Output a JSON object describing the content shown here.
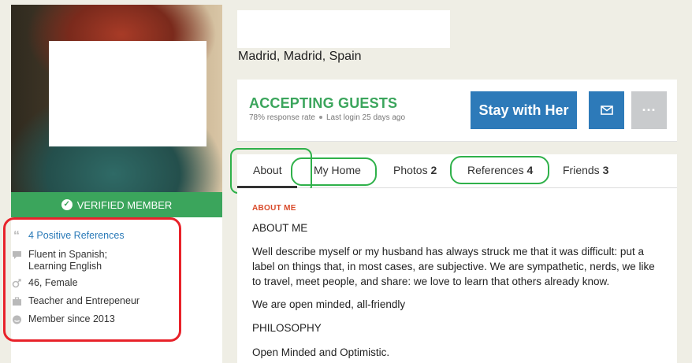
{
  "profile": {
    "verified_label": "VERIFIED MEMBER",
    "info": [
      {
        "icon": "quote-icon",
        "text": "4 Positive References",
        "link": true
      },
      {
        "icon": "speech-bubble-icon",
        "text": "Fluent in Spanish;",
        "text2": "Learning English"
      },
      {
        "icon": "gender-icon",
        "text": "46, Female"
      },
      {
        "icon": "briefcase-icon",
        "text": "Teacher and Entrepeneur"
      },
      {
        "icon": "couchsurfing-logo-icon",
        "text": "Member since 2013"
      }
    ]
  },
  "header": {
    "location": "Madrid, Madrid, Spain"
  },
  "host_card": {
    "status": "ACCEPTING GUESTS",
    "response_rate": "78% response rate",
    "last_login": "Last login 25 days ago",
    "stay_button": "Stay with Her",
    "message_icon": "envelope-icon",
    "more_icon": "ellipsis-icon"
  },
  "tabs": [
    {
      "label": "About",
      "count": ""
    },
    {
      "label": "My Home",
      "count": ""
    },
    {
      "label": "Photos",
      "count": "2"
    },
    {
      "label": "References",
      "count": "4"
    },
    {
      "label": "Friends",
      "count": "3"
    }
  ],
  "about": {
    "section_label": "ABOUT ME",
    "heading": "ABOUT ME",
    "paragraph": "Well describe myself or my husband has always struck me that it was difficult: put a label on things that, in most cases, are subjective. We are sympathetic, nerds, we like to travel, meet people, and share: we love to learn that others already know.",
    "line2": "We are open minded, all-friendly",
    "philosophy_heading": "PHILOSOPHY",
    "philosophy": "Open Minded and Optimistic."
  },
  "colors": {
    "accent_green": "#3ba55c",
    "button_blue": "#2d7ab9",
    "highlight_red": "#e8222a",
    "highlight_green": "#2fb14a",
    "section_label": "#d94b2b"
  }
}
